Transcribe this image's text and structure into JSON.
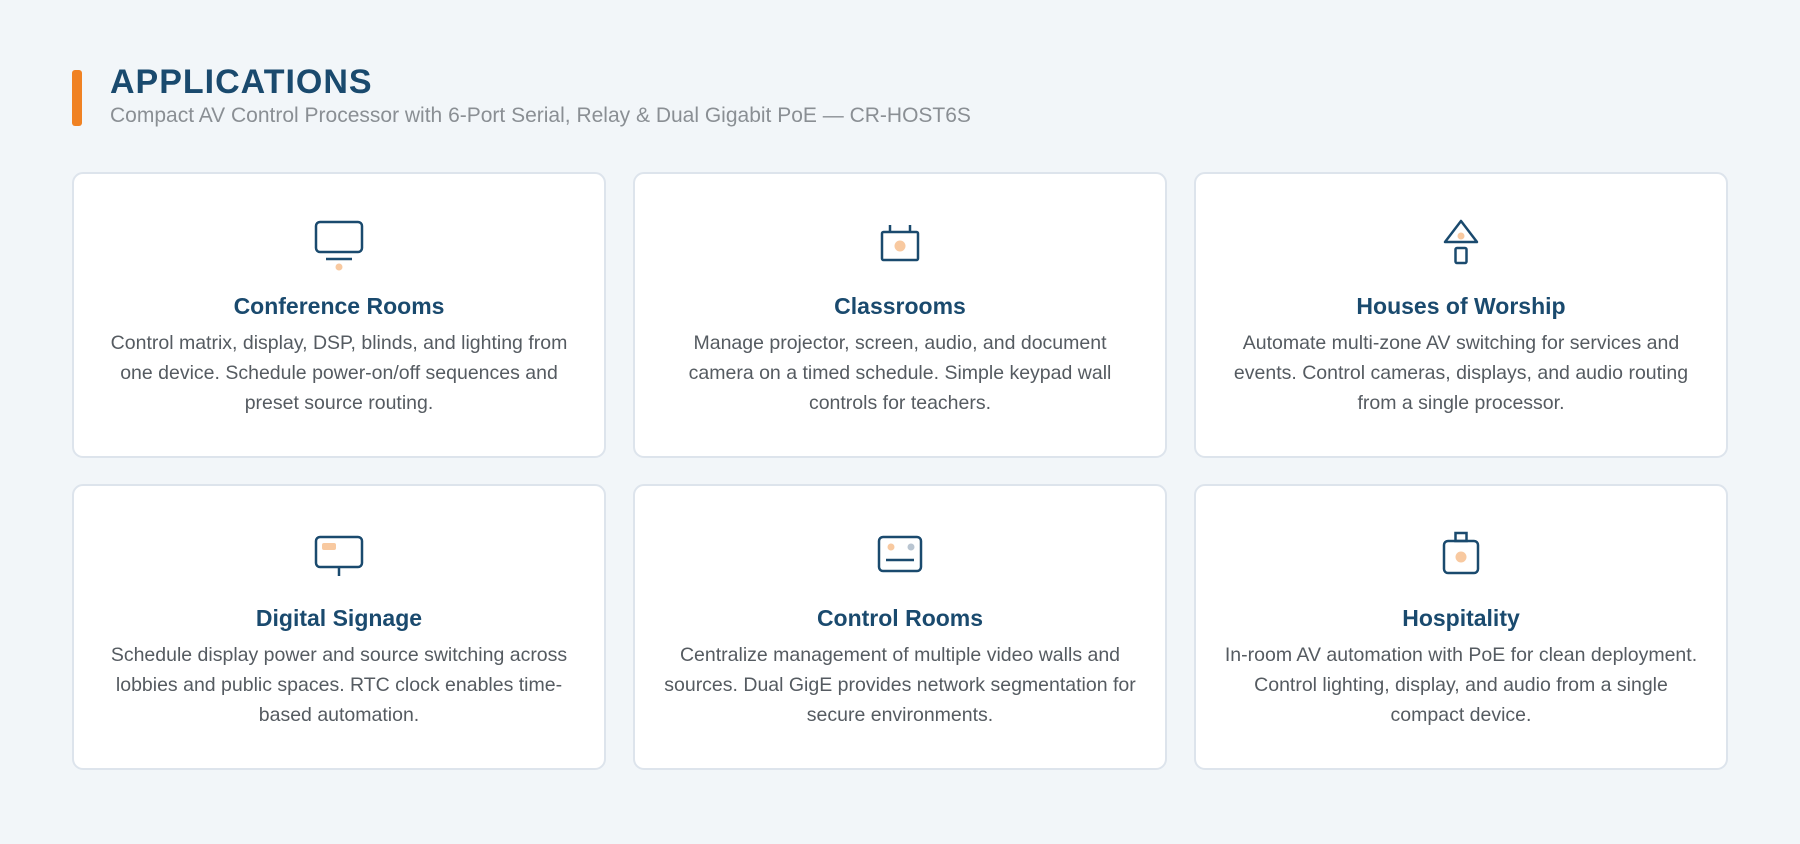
{
  "header": {
    "title": "APPLICATIONS",
    "subtitle": "Compact AV Control Processor with 6-Port Serial, Relay & Dual Gigabit PoE — CR-HOST6S"
  },
  "colors": {
    "accent": "#f08223",
    "primary": "#1a4a6e",
    "icon_highlight": "#f8c9a0",
    "text_secondary": "#555b61"
  },
  "cards": [
    {
      "icon": "monitor-icon",
      "title": "Conference Rooms",
      "description": "Control matrix, display, DSP, blinds, and lighting from one device. Schedule power-on/off sequences and preset source routing."
    },
    {
      "icon": "projector-icon",
      "title": "Classrooms",
      "description": "Manage projector, screen, audio, and document camera on a timed schedule. Simple keypad wall controls for teachers."
    },
    {
      "icon": "worship-icon",
      "title": "Houses of Worship",
      "description": "Automate multi-zone AV switching for services and events. Control cameras, displays, and audio routing from a single processor."
    },
    {
      "icon": "signage-icon",
      "title": "Digital Signage",
      "description": "Schedule display power and source switching across lobbies and public spaces. RTC clock enables time-based automation."
    },
    {
      "icon": "control-panel-icon",
      "title": "Control Rooms",
      "description": "Centralize management of multiple video walls and sources. Dual GigE provides network segmentation for secure environments."
    },
    {
      "icon": "hospitality-icon",
      "title": "Hospitality",
      "description": "In-room AV automation with PoE for clean deployment. Control lighting, display, and audio from a single compact device."
    }
  ]
}
